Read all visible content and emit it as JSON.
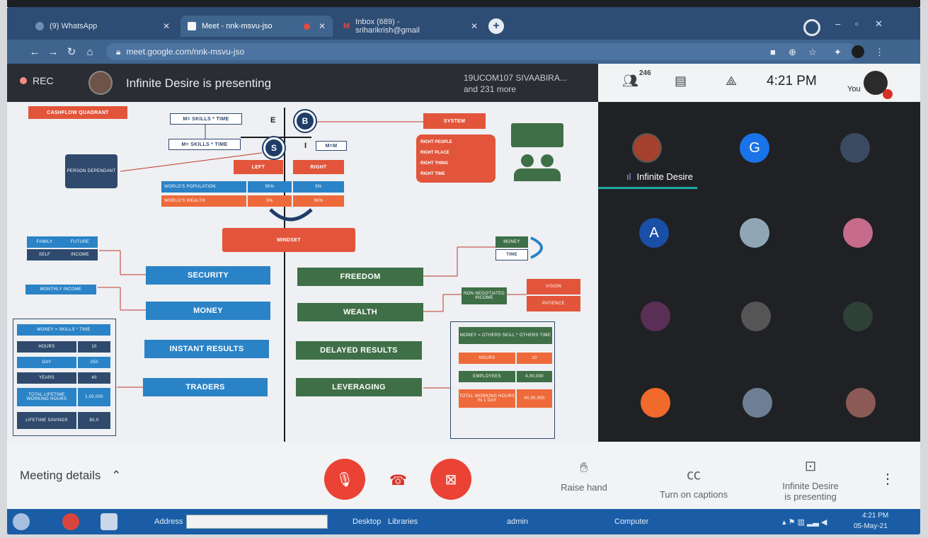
{
  "browser": {
    "tabs": [
      {
        "label": "(9) WhatsApp"
      },
      {
        "label": "Meet - nnk-msvu-jso"
      },
      {
        "label": "Inbox (689) - sriharikrish@gmail"
      }
    ],
    "new_tab": "+",
    "url": "meet.google.com/nnk-msvu-jso"
  },
  "meeting": {
    "rec_label": "REC",
    "presenting_title": "Infinite Desire is presenting",
    "participants_line1": "19UCOM107 SIVAABIRA...",
    "participants_line2": "and 231 more",
    "people_count": "246",
    "clock": "4:21 PM",
    "you_label": "You",
    "active_speaker": "Infinite Desire",
    "avatar_letters": [
      "G",
      "A"
    ]
  },
  "slide": {
    "top_left_button": "CASHFLOW QUADRANT",
    "formula1": "M= SKILLS * TIME",
    "formula2": "M= SKILLS * TIME",
    "q_e": "E",
    "q_b": "B",
    "q_s": "S",
    "q_i": "I",
    "mm_label": "M=M",
    "system": "SYSTEM",
    "right_people": "RIGHT PEOPLE",
    "right_place": "RIGHT PLACE",
    "right_thing": "RIGHT THING",
    "right_time": "RIGHT TIME",
    "person_dependant": "PERSON DEPENDANT",
    "left": "LEFT",
    "right": "RIGHT",
    "world_population": "WORLD'S POPULATION",
    "world_wealth": "WORLD'S WEALTH",
    "pct_95": "95%",
    "pct_5": "5%",
    "pct_5b": "5%",
    "pct_95b": "95%",
    "mindset": "MINDSET",
    "family": "FAMILY",
    "future": "FUTURE",
    "self": "SELF",
    "income": "INCOME",
    "monthly_income": "MONTHLY INCOME",
    "money_skills_time": "MONEY = SKILLS * TIME",
    "hours": "HOURS",
    "hours_val": "10",
    "day": "DAY",
    "day_val": "250",
    "years": "YEARS",
    "years_val": "40",
    "total_hours": "TOTAL LIFETIME WORKING HOURS",
    "total_hours_val": "1,00,000",
    "total_hours_note": "LIFETIME SAVINGS",
    "total_hours_note_val": "80,0",
    "security": "SECURITY",
    "money": "MONEY",
    "instant_results": "INSTANT RESULTS",
    "traders": "TRADERS",
    "freedom": "FREEDOM",
    "wealth": "WEALTH",
    "delayed_results": "DELAYED RESULTS",
    "leveraging": "LEVERAGING",
    "money_tag": "MONEY",
    "time_tag": "TIME",
    "non_negotiated_income": "NON-NEGOTIATED INCOME",
    "vision": "VISION",
    "patience": "PATIENCE",
    "money_others_skill": "MONEY = OTHERS SKILL * OTHERS TIME",
    "r_hours": "HOURS",
    "r_hours_val": "10",
    "r_employees": "EMPLOYEES",
    "r_employees_val": "4,00,000",
    "r_total": "TOTAL WORKING HOURS IN 1 DAY",
    "r_total_val": "40,00,000"
  },
  "controls": {
    "meeting_details": "Meeting details",
    "raise_hand": "Raise hand",
    "captions": "Turn on captions",
    "presenting_line1": "Infinite Desire",
    "presenting_line2": "is presenting"
  },
  "taskbar": {
    "address": "Address",
    "desktop": "Desktop",
    "libraries": "Libraries",
    "admin": "admin",
    "computer": "Computer",
    "time": "4:21 PM",
    "date": "05-May-21"
  },
  "colors": {
    "meet_red": "#ea4335",
    "slide_blue": "#2a83c6",
    "slide_green": "#3f6f46",
    "slide_orange": "#ee6a3a",
    "tab_bar": "#2e4d74",
    "taskbar": "#1a5da6"
  }
}
